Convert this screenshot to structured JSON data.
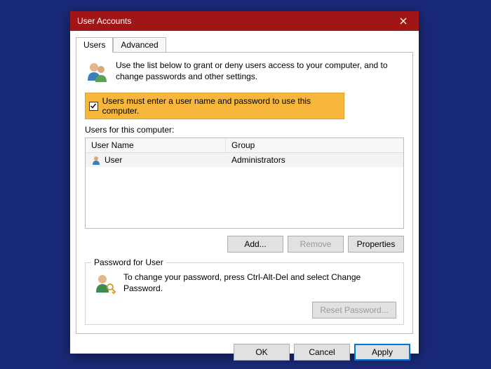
{
  "window": {
    "title": "User Accounts"
  },
  "tabs": {
    "users": "Users",
    "advanced": "Advanced"
  },
  "intro": "Use the list below to grant or deny users access to your computer, and to change passwords and other settings.",
  "checkbox": {
    "label": "Users must enter a user name and password to use this computer."
  },
  "usersList": {
    "label": "Users for this computer:",
    "columns": {
      "username": "User Name",
      "group": "Group"
    },
    "rows": [
      {
        "username": "User",
        "group": "Administrators"
      }
    ]
  },
  "buttons": {
    "add": "Add...",
    "remove": "Remove",
    "properties": "Properties"
  },
  "passwordBox": {
    "legend": "Password for User",
    "text": "To change your password, press Ctrl-Alt-Del and select Change Password.",
    "reset": "Reset Password..."
  },
  "footer": {
    "ok": "OK",
    "cancel": "Cancel",
    "apply": "Apply"
  }
}
